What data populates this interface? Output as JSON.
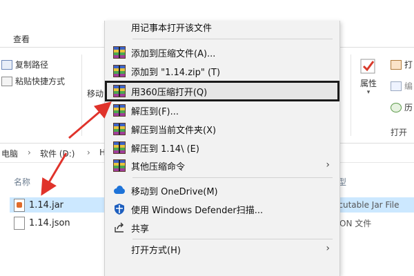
{
  "ribbon": {
    "tab_view": "查看",
    "copy_path": "复制路径",
    "paste_shortcut": "粘贴快捷方式",
    "move_to": "移动",
    "properties": "属性",
    "open_group": "打开",
    "open_item": "打",
    "edit_item": "编",
    "history_item": "历"
  },
  "address": {
    "this_pc": "电脑",
    "drive": "软件 (D:)",
    "folder_fragment": "H"
  },
  "columns": {
    "name": "名称",
    "type_fragment": "型"
  },
  "files": [
    {
      "name": "1.14.jar",
      "type": "ecutable Jar File"
    },
    {
      "name": "1.14.json",
      "type": "ON 文件"
    }
  ],
  "menu": {
    "item_open_notepad": "用记事本打开该文件",
    "item_add_archive": "添加到压缩文件(A)...",
    "item_add_zip": "添加到 \"1.14.zip\" (T)",
    "item_open_360": "用360压缩打开(Q)",
    "item_extract_to": "解压到(F)...",
    "item_extract_here": "解压到当前文件夹(X)",
    "item_extract_folder": "解压到 1.14\\ (E)",
    "item_other_compress": "其他压缩命令",
    "item_onedrive": "移动到 OneDrive(M)",
    "item_defender": "使用 Windows Defender扫描...",
    "item_share": "共享",
    "item_open_with": "打开方式(H)"
  },
  "colors": {
    "highlight_border": "#1a1a1a",
    "arrow": "#e0332b",
    "selected_row": "#cce8ff"
  }
}
